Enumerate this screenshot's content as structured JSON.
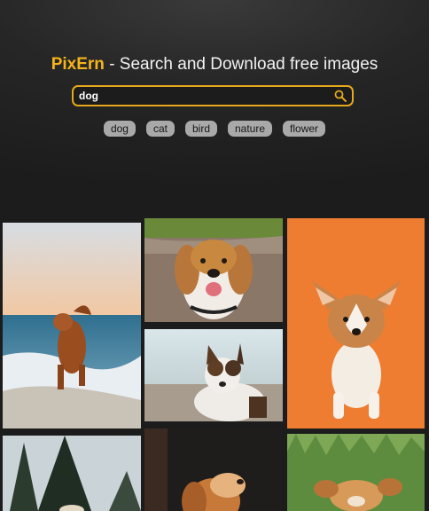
{
  "header": {
    "brand": "PixErn",
    "tagline": "- Search and Download free images"
  },
  "search": {
    "value": "dog",
    "icon": "search-icon"
  },
  "tags": [
    "dog",
    "cat",
    "bird",
    "nature",
    "flower"
  ],
  "colors": {
    "accent": "#f4b41a",
    "tag_bg": "#a9a9a9",
    "page_bg": "#1c1c1c"
  },
  "gallery": {
    "photos": [
      {
        "subject": "dog running in ocean surf"
      },
      {
        "subject": "smiling beagle"
      },
      {
        "subject": "border collie on beach"
      },
      {
        "subject": "corgi puppy on orange background"
      },
      {
        "subject": "trees and sky"
      },
      {
        "subject": "spaniel on dark background"
      },
      {
        "subject": "puppy in grass"
      }
    ]
  }
}
